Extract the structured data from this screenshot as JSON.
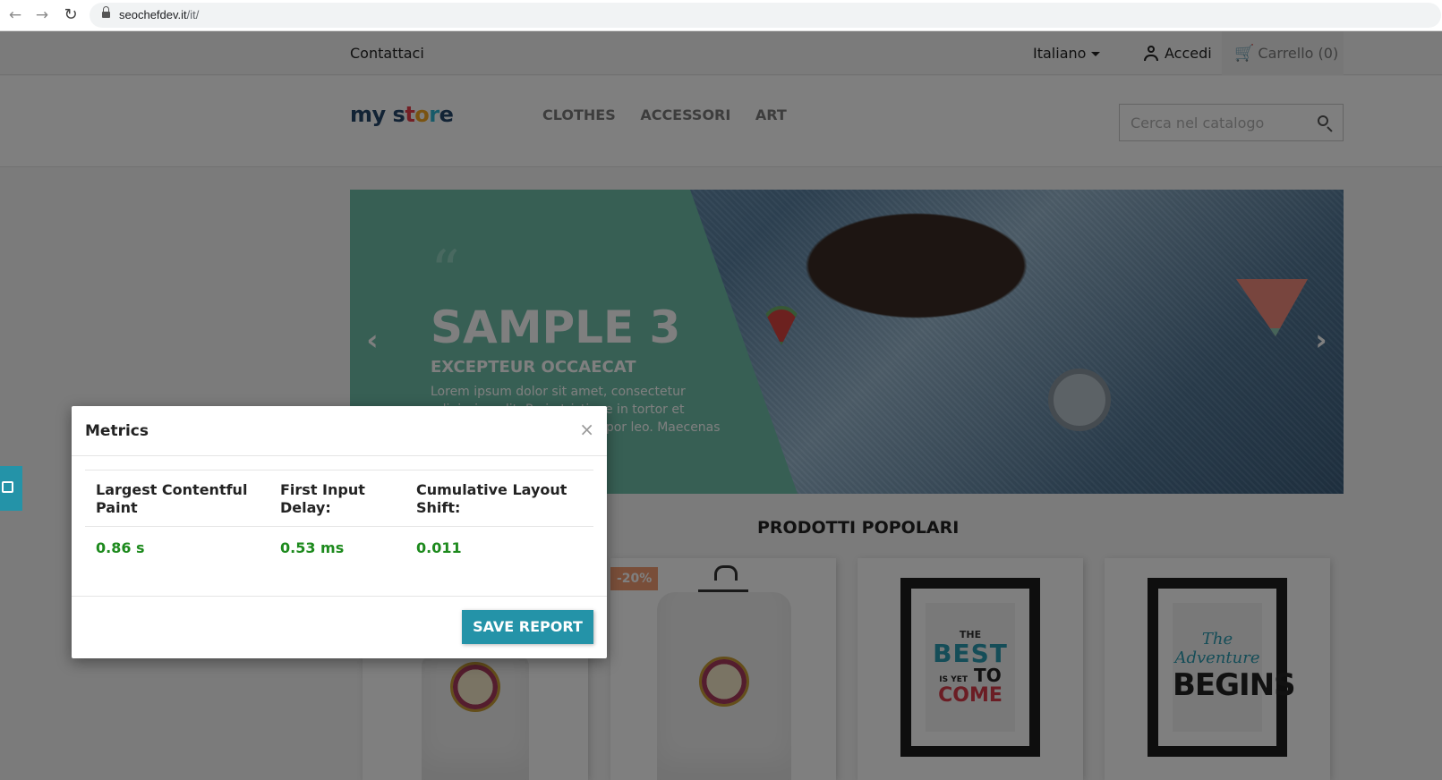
{
  "browser": {
    "url_host": "seochefdev.it",
    "url_path": "/it/"
  },
  "topbar": {
    "contact": "Contattaci",
    "language": "Italiano",
    "sign_in": "Accedi",
    "cart": "Carrello (0)"
  },
  "header": {
    "logo_text": "my store",
    "menu": [
      "CLOTHES",
      "ACCESSORI",
      "ART"
    ],
    "search_placeholder": "Cerca nel catalogo"
  },
  "slider": {
    "quote": "“",
    "title": "SAMPLE 3",
    "subtitle": "EXCEPTEUR OCCAECAT",
    "text": "Lorem ipsum dolor sit amet, consectetur adipiscing elit. Proin tristique in tortor et dignissim. Quisque non tempor leo. Maecenas"
  },
  "products": {
    "section_title": "PRODOTTI POPOLARI",
    "discount_badge": "-20%",
    "art1": {
      "the": "THE",
      "best": "BEST",
      "is_yet": "IS YET",
      "to": "TO",
      "come": "COME"
    },
    "art2": {
      "the_adventure": "The Adventure",
      "begins": "BEGINS"
    }
  },
  "modal": {
    "title": "Metrics",
    "close": "×",
    "headers": [
      "Largest Contentful Paint",
      "First Input Delay:",
      "Cumulative Layout Shift:"
    ],
    "values": [
      "0.86 s",
      "0.53 ms",
      "0.011"
    ],
    "save_button": "SAVE REPORT"
  },
  "colors": {
    "accent": "#2493a8",
    "metric_good": "#1d8a1d",
    "slide_panel": "#6ebfa9",
    "discount": "#f39d72"
  }
}
